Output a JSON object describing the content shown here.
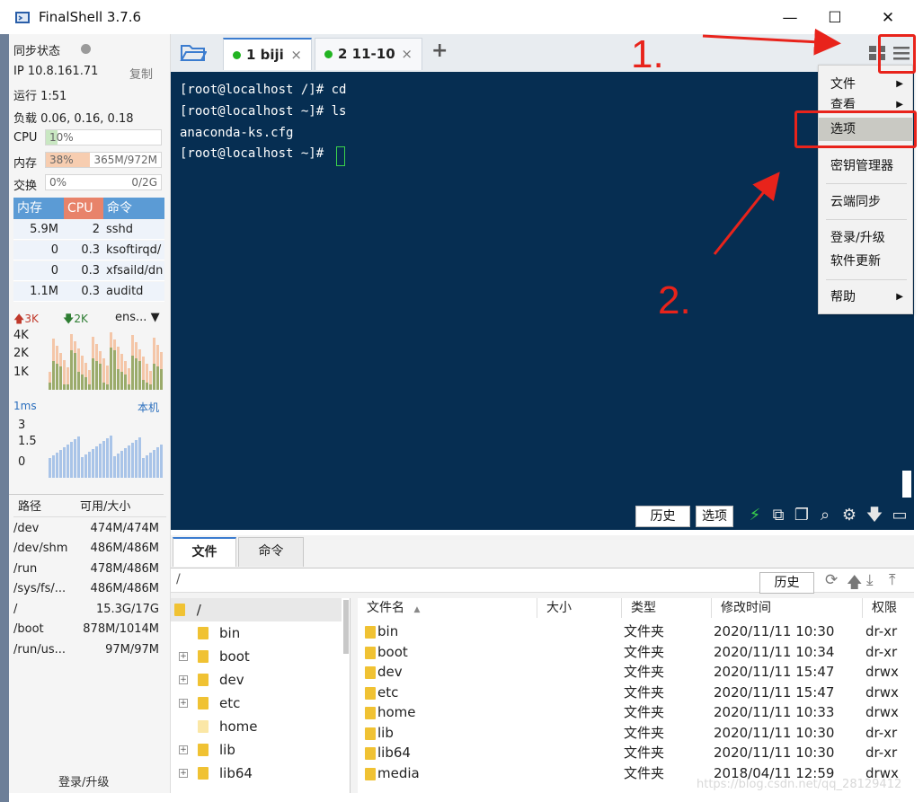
{
  "window": {
    "title": "FinalShell 3.7.6",
    "controls": [
      "—",
      "☐",
      "✕"
    ]
  },
  "left_panel": {
    "sync_status": "同步状态",
    "ip_label": "IP 10.8.161.71",
    "copy_label": "复制",
    "uptime": "运行 1:51",
    "load": "负载 0.06, 0.16, 0.18",
    "cpu_label": "CPU",
    "cpu_value": "10%",
    "cpu_fraction": 0.1,
    "mem_label": "内存",
    "mem_percent": "38%",
    "mem_fraction": 0.38,
    "mem_value": "365M/972M",
    "swap_label": "交换",
    "swap_percent": "0%",
    "swap_value": "0/2G",
    "proc_headers": [
      "内存",
      "CPU",
      "命令"
    ],
    "processes": [
      {
        "mem": "5.9M",
        "cpu": "2",
        "cmd": "sshd"
      },
      {
        "mem": "0",
        "cpu": "0.3",
        "cmd": "ksoftirqd/"
      },
      {
        "mem": "0",
        "cpu": "0.3",
        "cmd": "xfsaild/dn"
      },
      {
        "mem": "1.1M",
        "cpu": "0.3",
        "cmd": "auditd"
      }
    ],
    "net_up": "3K",
    "net_down": "2K",
    "net_iface": "ens...",
    "net_scale": [
      "4K",
      "2K",
      "1K"
    ],
    "ping_label": "1ms",
    "ping_target": "本机",
    "ping_scale": [
      "3",
      "1.5",
      "0"
    ],
    "disk_headers": [
      "路径",
      "可用/大小"
    ],
    "disks": [
      {
        "path": "/dev",
        "size": "474M/474M"
      },
      {
        "path": "/dev/shm",
        "size": "486M/486M"
      },
      {
        "path": "/run",
        "size": "478M/486M"
      },
      {
        "path": "/sys/fs/...",
        "size": "486M/486M"
      },
      {
        "path": "/",
        "size": "15.3G/17G"
      },
      {
        "path": "/boot",
        "size": "878M/1014M"
      },
      {
        "path": "/run/us...",
        "size": "97M/97M"
      }
    ],
    "login_upgrade": "登录/升级"
  },
  "tabs": [
    {
      "label": "1 biji",
      "close": "×"
    },
    {
      "label": "2 11-10",
      "close": "×"
    }
  ],
  "add_tab": "+",
  "terminal": {
    "lines": [
      "[root@localhost /]# cd",
      "[root@localhost ~]# ls",
      "anaconda-ks.cfg",
      "[root@localhost ~]# "
    ]
  },
  "menu": {
    "items": [
      {
        "label": "文件",
        "sub": "▶"
      },
      {
        "label": "查看",
        "sub": "▶"
      },
      {
        "label": "选项",
        "sub": ""
      },
      {
        "label": "密钥管理器",
        "sub": ""
      },
      {
        "label": "云端同步",
        "sub": ""
      },
      {
        "label": "登录/升级",
        "sub": ""
      },
      {
        "label": "软件更新",
        "sub": ""
      },
      {
        "label": "帮助",
        "sub": "▶"
      }
    ]
  },
  "annotations": {
    "step1": "1.",
    "step2": "2."
  },
  "terminal_toolbar": {
    "history": "历史",
    "options": "选项"
  },
  "bottom": {
    "tabs": [
      "文件",
      "命令"
    ],
    "path": "/",
    "history": "历史",
    "tree_root": "/",
    "tree_items": [
      "bin",
      "boot",
      "dev",
      "etc",
      "home",
      "lib",
      "lib64"
    ],
    "file_headers": [
      "文件名",
      "大小",
      "类型",
      "修改时间",
      "权限"
    ],
    "sort_indicator": "▲",
    "files": [
      {
        "name": "bin",
        "size": "",
        "type": "文件夹",
        "mtime": "2020/11/11 10:30",
        "perm": "dr-xr"
      },
      {
        "name": "boot",
        "size": "",
        "type": "文件夹",
        "mtime": "2020/11/11 10:34",
        "perm": "dr-xr"
      },
      {
        "name": "dev",
        "size": "",
        "type": "文件夹",
        "mtime": "2020/11/11 15:47",
        "perm": "drwx"
      },
      {
        "name": "etc",
        "size": "",
        "type": "文件夹",
        "mtime": "2020/11/11 15:47",
        "perm": "drwx"
      },
      {
        "name": "home",
        "size": "",
        "type": "文件夹",
        "mtime": "2020/11/11 10:33",
        "perm": "drwx"
      },
      {
        "name": "lib",
        "size": "",
        "type": "文件夹",
        "mtime": "2020/11/11 10:30",
        "perm": "dr-xr"
      },
      {
        "name": "lib64",
        "size": "",
        "type": "文件夹",
        "mtime": "2020/11/11 10:30",
        "perm": "dr-xr"
      },
      {
        "name": "media",
        "size": "",
        "type": "文件夹",
        "mtime": "2018/04/11 12:59",
        "perm": "drwx"
      }
    ],
    "watermark": "https://blog.csdn.net/qq_28129412"
  },
  "colors": {
    "terminal_bg": "#062e52",
    "accent_blue": "#5b9bd5",
    "cpu_header": "#e8836a",
    "annotation_red": "#e8231b"
  }
}
